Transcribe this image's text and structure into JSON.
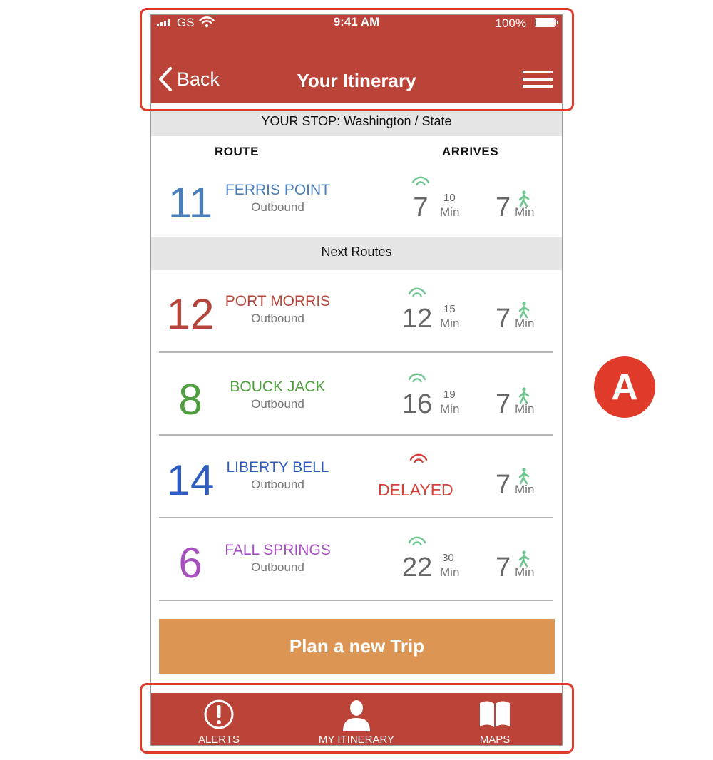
{
  "status_bar": {
    "carrier": "GS",
    "time": "9:41 AM",
    "battery": "100%"
  },
  "header": {
    "back_label": "Back",
    "title": "Your Itinerary"
  },
  "stop": {
    "label": "YOUR STOP: Washington / State"
  },
  "columns": {
    "route": "ROUTE",
    "arrives": "ARRIVES"
  },
  "next_routes_label": "Next Routes",
  "routes": [
    {
      "number": "11",
      "name": "FERRIS POINT",
      "direction": "Outbound",
      "color": "#4a7fb9",
      "realtime": "7",
      "scheduled": "10",
      "unit": "Min",
      "walk": "7",
      "walk_unit": "Min",
      "signal_color": "#6ec58f"
    },
    {
      "number": "12",
      "name": "PORT MORRIS",
      "direction": "Outbound",
      "color": "#b3453a",
      "realtime": "12",
      "scheduled": "15",
      "unit": "Min",
      "walk": "7",
      "walk_unit": "Min",
      "signal_color": "#6ec58f"
    },
    {
      "number": "8",
      "name": "BOUCK JACK",
      "direction": "Outbound",
      "color": "#4f9f3e",
      "realtime": "16",
      "scheduled": "19",
      "unit": "Min",
      "walk": "7",
      "walk_unit": "Min",
      "signal_color": "#6ec58f"
    },
    {
      "number": "14",
      "name": "LIBERTY BELL",
      "direction": "Outbound",
      "color": "#2d5bc0",
      "status": "DELAYED",
      "walk": "7",
      "walk_unit": "Min",
      "signal_color": "#d8403a"
    },
    {
      "number": "6",
      "name": "FALL SPRINGS",
      "direction": "Outbound",
      "color": "#a64fbf",
      "realtime": "22",
      "scheduled": "30",
      "unit": "Min",
      "walk": "7",
      "walk_unit": "Min",
      "signal_color": "#6ec58f"
    }
  ],
  "plan_button": "Plan a new  Trip",
  "tabs": [
    {
      "label": "ALERTS",
      "icon": "alert-icon"
    },
    {
      "label": "MY ITINERARY",
      "icon": "user-icon"
    },
    {
      "label": "MAPS",
      "icon": "book-icon"
    }
  ],
  "annotation": {
    "badge": "A"
  },
  "colors": {
    "header": "#bc4338",
    "button": "#dd9553",
    "walk_icon": "#6ec58f",
    "callout": "#e03a2b"
  }
}
